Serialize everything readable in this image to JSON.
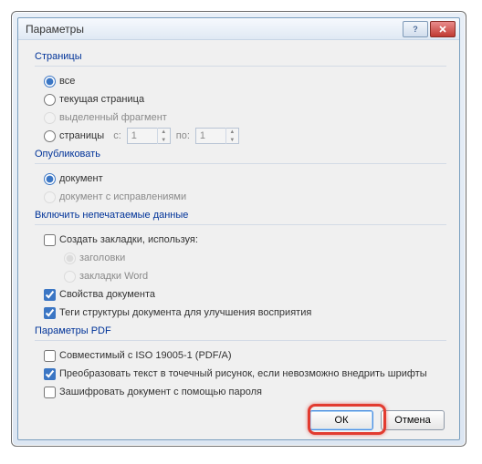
{
  "title": "Параметры",
  "groups": {
    "pages": {
      "label": "Страницы",
      "all": "все",
      "current": "текущая страница",
      "selection": "выделенный фрагмент",
      "range": "страницы",
      "from_label": "с:",
      "to_label": "по:",
      "from_value": "1",
      "to_value": "1"
    },
    "publish": {
      "label": "Опубликовать",
      "document": "документ",
      "markup": "документ с исправлениями"
    },
    "nonprint": {
      "label": "Включить непечатаемые данные",
      "bookmarks": "Создать закладки, используя:",
      "headings": "заголовки",
      "word_bookmarks": "закладки Word",
      "props": "Свойства документа",
      "tags": "Теги структуры документа для улучшения восприятия"
    },
    "pdf": {
      "label": "Параметры PDF",
      "iso": "Совместимый с ISO 19005-1 (PDF/A)",
      "bitmap": "Преобразовать текст в точечный рисунок, если невозможно внедрить шрифты",
      "encrypt": "Зашифровать документ с помощью пароля"
    }
  },
  "buttons": {
    "ok": "ОК",
    "cancel": "Отмена"
  }
}
